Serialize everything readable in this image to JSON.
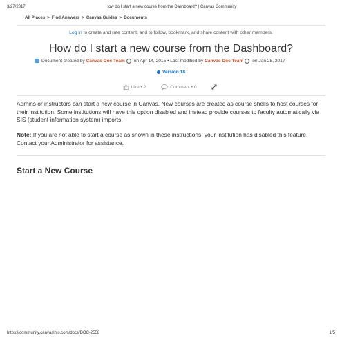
{
  "print_header": {
    "date": "3/27/2017",
    "title": "How do I start a new course from the Dashboard? | Canvas Community"
  },
  "breadcrumb": [
    "All Places",
    "Find Answers",
    "Canvas Guides",
    "Documents"
  ],
  "breadcrumb_separator": ">",
  "login_notice": {
    "link": "Log in",
    "text": " to create and rate content, and to follow, bookmark, and share content with other members."
  },
  "doc_title": "How do I start a new course from the Dashboard?",
  "meta": {
    "created_prefix": "Document created by ",
    "created_author": "Canvas Doc Team",
    "created_date": " on Apr 14, 2015",
    "modified_prefix": " • Last modified by ",
    "modified_author": "Canvas Doc Team",
    "modified_date": " on Jan 28, 2017"
  },
  "version": "Version 18",
  "actions": {
    "like_label": "Like",
    "like_count": "2",
    "comment_label": "Comment",
    "comment_count": "0",
    "dot": "•"
  },
  "body": {
    "intro": "Admins or instructors can start a new course in Canvas. New courses are created as course shells to host courses for their institution. Some institutions will have this option disabled and instead provide courses to faculty automatically via SIS (student information system) imports.",
    "note_label": "Note:",
    "note_text": " If you are not able to start a course as shown in these instructions, your institution has disabled this feature. Contact your Administrator for assistance."
  },
  "section_title": "Start a New Course",
  "footer": {
    "url": "https://community.canvaslms.com/docs/DOC-2558",
    "page": "1/5"
  },
  "colors": {
    "author": "#c84f2c",
    "link": "#1a73c4"
  }
}
